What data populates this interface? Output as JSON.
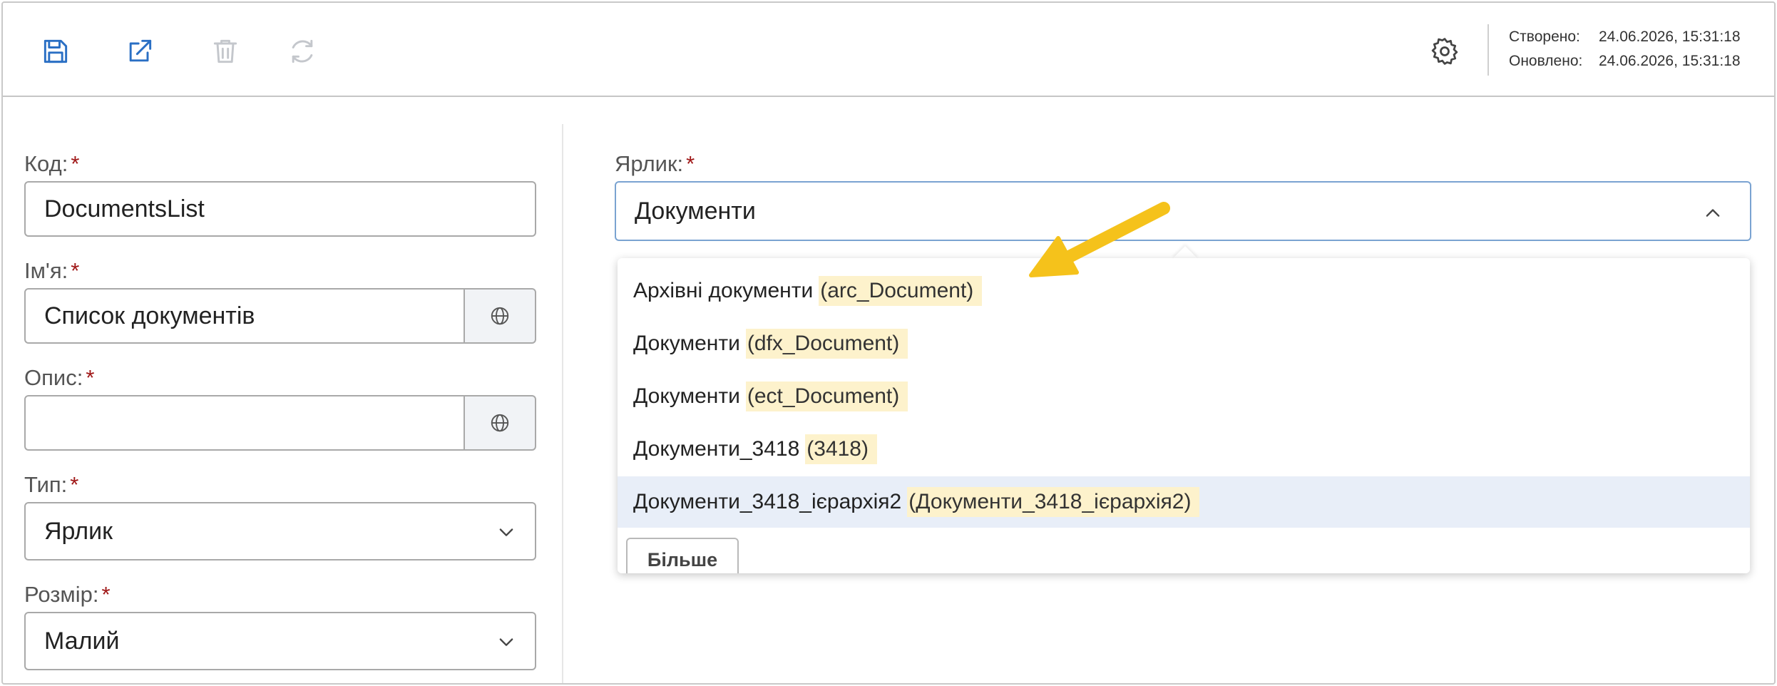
{
  "toolbar": {
    "icons": {
      "save": "save-icon",
      "open": "open-external-icon",
      "delete": "trash-icon",
      "refresh": "refresh-icon",
      "settings": "gear-icon"
    },
    "created_label": "Створено:",
    "created_value": "24.06.2026, 15:31:18",
    "updated_label": "Оновлено:",
    "updated_value": "24.06.2026, 15:31:18"
  },
  "form": {
    "required_mark": "*",
    "code": {
      "label": "Код:",
      "value": "DocumentsList"
    },
    "name": {
      "label": "Ім'я:",
      "value": "Список документів"
    },
    "description": {
      "label": "Опис:",
      "value": ""
    },
    "type": {
      "label": "Тип:",
      "value": "Ярлик"
    },
    "size": {
      "label": "Розмір:",
      "value": "Малий"
    },
    "shortcut": {
      "label": "Ярлик:",
      "value": "Документи"
    }
  },
  "dropdown": {
    "options": [
      {
        "label": "Архівні документи",
        "code": "(arc_Document)"
      },
      {
        "label": "Документи",
        "code": "(dfx_Document)"
      },
      {
        "label": "Документи",
        "code": "(ect_Document)"
      },
      {
        "label": "Документи_3418",
        "code": "(3418)"
      },
      {
        "label": "Документи_3418_ієрархія2",
        "code": "(Документи_3418_ієрархія2)"
      }
    ],
    "more_label": "Більше"
  },
  "colors": {
    "accent_blue": "#2a6fc4",
    "disabled_icon": "#c4c7cc",
    "highlight": "#fdf2cc",
    "active_row": "#e8eef8",
    "required": "#a01818",
    "arrow": "#f5c21b"
  }
}
